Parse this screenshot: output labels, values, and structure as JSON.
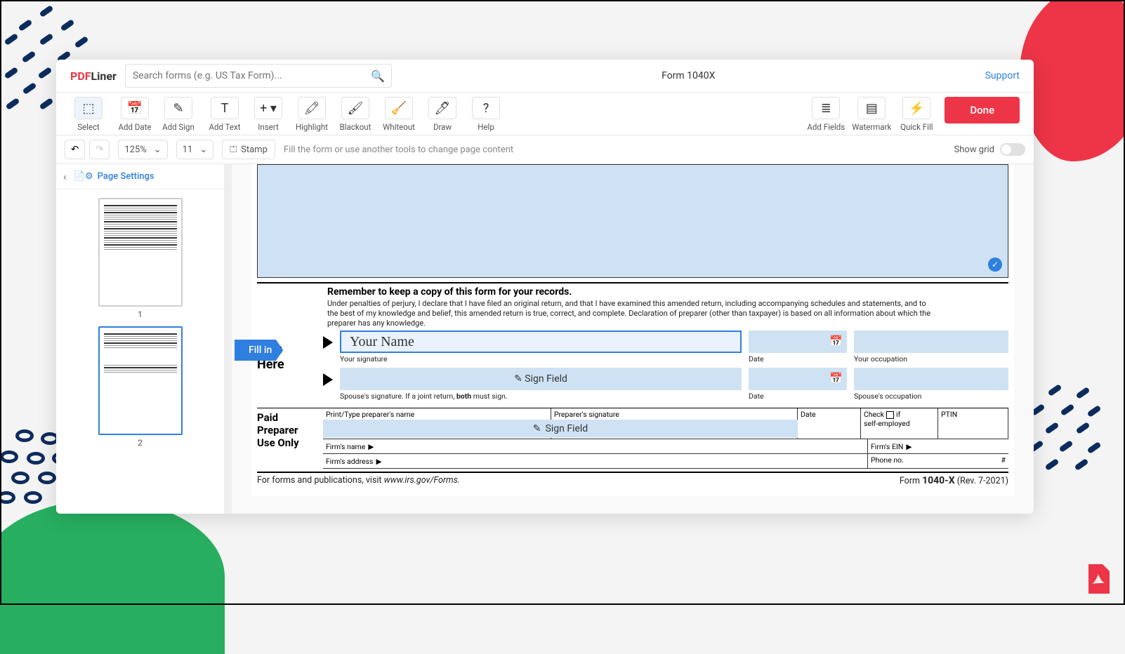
{
  "header": {
    "logo_prefix": "PDF",
    "logo_suffix": "Liner",
    "search_placeholder": "Search forms (e.g. US Tax Form)...",
    "title": "Form 1040X",
    "support": "Support"
  },
  "toolbar": {
    "select": "Select",
    "add_date": "Add Date",
    "add_sign": "Add Sign",
    "add_text": "Add Text",
    "insert": "Insert",
    "highlight": "Highlight",
    "blackout": "Blackout",
    "whiteout": "Whiteout",
    "draw": "Draw",
    "help": "Help",
    "add_fields": "Add Fields",
    "watermark": "Watermark",
    "quick_fill": "Quick Fill",
    "done": "Done"
  },
  "subbar": {
    "zoom": "125%",
    "font_size": "11",
    "stamp": "Stamp",
    "hint": "Fill the form or use another tools to change page content",
    "show_grid": "Show grid"
  },
  "side": {
    "page_settings": "Page Settings",
    "page1": "1",
    "page2": "2"
  },
  "fillin": "Fill in",
  "doc": {
    "remember": "Remember to keep a copy of this form for your records.",
    "declaration": "Under penalties of perjury, I declare that I have filed an original return, and that I have examined this amended return, including accompanying schedules and statements, and to the best of my knowledge and belief, this amended return is true, correct, and complete. Declaration of preparer (other than taxpayer) is based on all information about which the preparer has any knowledge.",
    "sign_here": "Sign Here",
    "your_name": "Your Name",
    "your_sig": "Your signature",
    "date": "Date",
    "your_occ": "Your occupation",
    "sign_field": "Sign Field",
    "spouse_sig_a": "Spouse's signature. If a joint return, ",
    "spouse_sig_b": "both",
    "spouse_sig_c": " must sign.",
    "spouse_occ": "Spouse's occupation",
    "paid_prep": "Paid Preparer Use Only",
    "p_name": "Print/Type preparer's name",
    "p_sig": "Preparer's signature",
    "p_date": "Date",
    "check_if": "Check",
    "check_if2": "if",
    "self_emp": "self-employed",
    "ptin": "PTIN",
    "firm_name": "Firm's name",
    "firm_ein": "Firm's EIN",
    "firm_addr": "Firm's address",
    "phone": "Phone no.",
    "hash": "#",
    "footer_a": "For forms and publications, visit ",
    "footer_b": "www.irs.gov/Forms.",
    "footer_c": "Form ",
    "footer_d": "1040-X",
    "footer_e": " (Rev. 7-2021)"
  }
}
